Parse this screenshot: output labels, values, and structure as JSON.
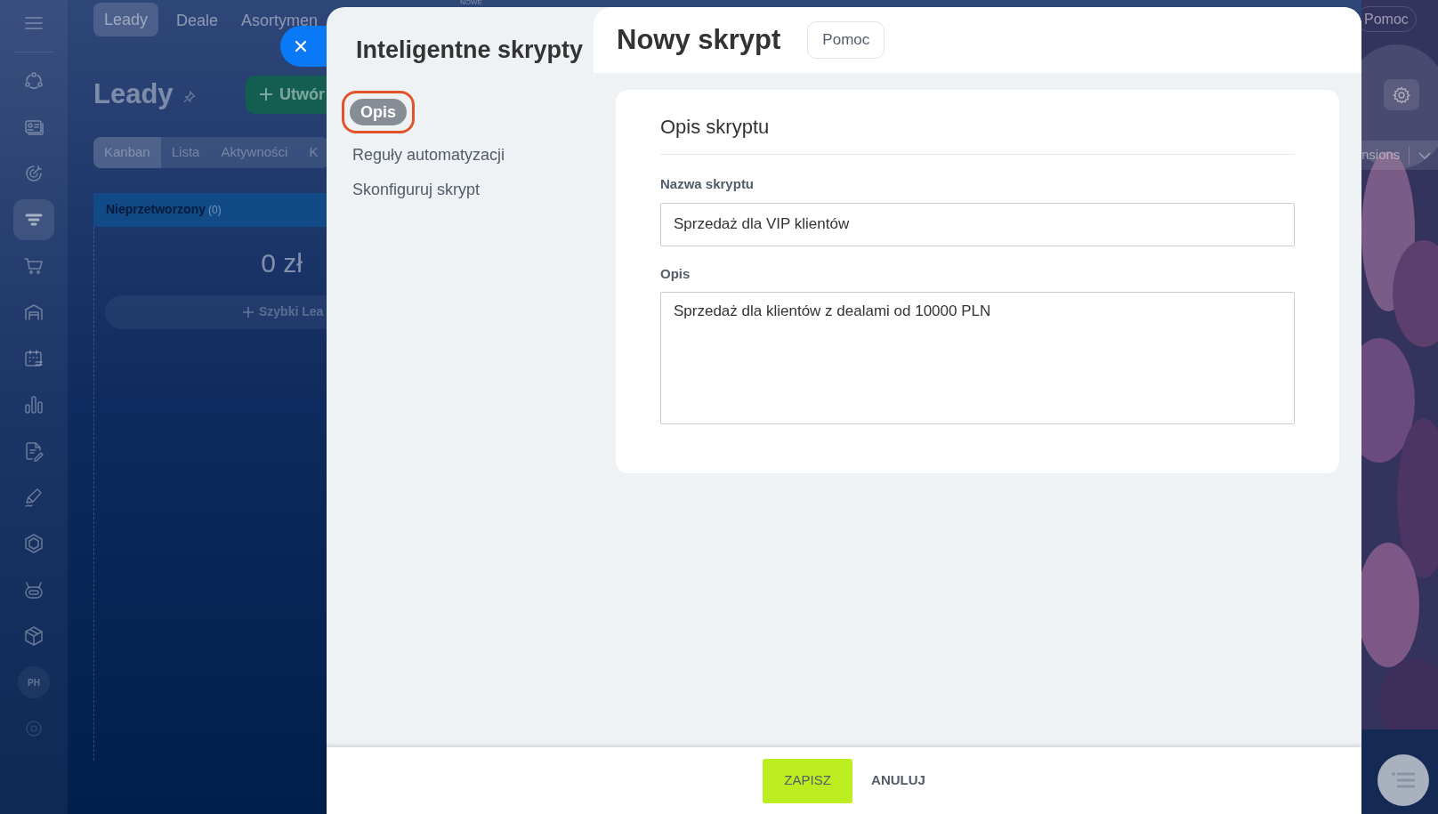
{
  "background_app": {
    "sidebar": {
      "items": [
        {
          "kind": "menu",
          "selected": false
        },
        {
          "kind": "flow",
          "selected": false
        },
        {
          "kind": "card",
          "selected": false
        },
        {
          "kind": "target",
          "selected": false
        },
        {
          "kind": "funnel",
          "selected": true
        },
        {
          "kind": "cart",
          "selected": false
        },
        {
          "kind": "garage",
          "selected": false
        },
        {
          "kind": "calendar",
          "selected": false
        },
        {
          "kind": "chart",
          "selected": false
        },
        {
          "kind": "doc",
          "selected": false
        },
        {
          "kind": "pen",
          "selected": false
        },
        {
          "kind": "hexagon",
          "selected": false
        },
        {
          "kind": "robot",
          "selected": false
        },
        {
          "kind": "box",
          "selected": false
        },
        {
          "kind": "avatar",
          "selected": false,
          "label": "PH"
        },
        {
          "kind": "gear",
          "selected": false
        }
      ]
    },
    "top_tabs": [
      {
        "label": "Leady",
        "selected": true
      },
      {
        "label": "Deale",
        "selected": false
      },
      {
        "label": "Asortymen",
        "selected": false
      }
    ],
    "new_badge": "NOWE",
    "page_title": "Leady",
    "create_button": "Utwór",
    "view_tabs": [
      {
        "label": "Kanban",
        "selected": true
      },
      {
        "label": "Lista",
        "selected": false
      },
      {
        "label": "Aktywności",
        "selected": false
      },
      {
        "label": "K",
        "selected": false
      }
    ],
    "column": {
      "title": "Nieprzetworzony",
      "count": "(0)",
      "total": "0 zł",
      "quick_add": "Szybki Lea"
    },
    "help_button": "Pomoc",
    "filter_chip": "nsions"
  },
  "panel": {
    "nav_title": "Inteligentne skrypty",
    "nav_items": [
      {
        "label": "Opis",
        "selected": true,
        "highlighted": true
      },
      {
        "label": "Reguły automatyzacji",
        "selected": false,
        "highlighted": false
      },
      {
        "label": "Skonfiguruj skrypt",
        "selected": false,
        "highlighted": false
      }
    ],
    "title": "Nowy skrypt",
    "help_button": "Pomoc",
    "section_title": "Opis skryptu",
    "fields": [
      {
        "kind": "input",
        "label": "Nazwa skryptu",
        "value": "Sprzedaż dla VIP klientów"
      },
      {
        "kind": "textarea",
        "label": "Opis",
        "value": "Sprzedaż dla klientów z dealami od 10000 PLN"
      }
    ],
    "buttons": [
      {
        "kind": "primary",
        "label": "ZAPISZ"
      },
      {
        "kind": "link",
        "label": "ANULUJ"
      }
    ]
  }
}
